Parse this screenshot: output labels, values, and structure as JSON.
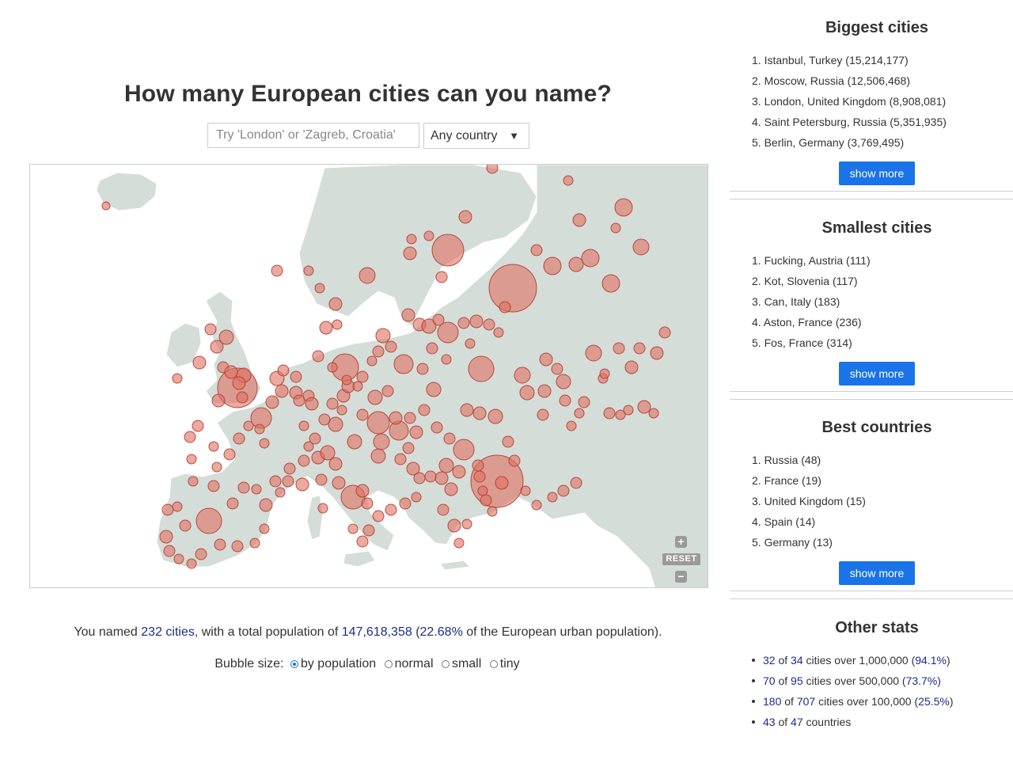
{
  "title": "How many European cities can you name?",
  "search": {
    "placeholder": "Try 'London' or 'Zagreb, Croatia'"
  },
  "country_select": {
    "selected": "Any country",
    "arrow": "▼"
  },
  "map": {
    "land_color": "#d4ddd8",
    "bubble_color": "#e07060",
    "zoom_in": "+",
    "reset": "RESET",
    "zoom_out": "−"
  },
  "summary": {
    "prefix": "You named ",
    "cities": "232 cities",
    "mid": ", with a total population of ",
    "population": "147,618,358",
    "open": " (",
    "percent": "22.68%",
    "suffix": " of the European urban population)."
  },
  "bubble_size": {
    "label": "Bubble size:",
    "options": [
      {
        "label": "by population",
        "checked": true
      },
      {
        "label": "normal",
        "checked": false
      },
      {
        "label": "small",
        "checked": false
      },
      {
        "label": "tiny",
        "checked": false
      }
    ]
  },
  "biggest": {
    "title": "Biggest cities",
    "items": [
      "1. Istanbul, Turkey (15,214,177)",
      "2. Moscow, Russia (12,506,468)",
      "3. London, United Kingdom (8,908,081)",
      "4. Saint Petersburg, Russia (5,351,935)",
      "5. Berlin, Germany (3,769,495)"
    ],
    "button": "show more"
  },
  "smallest": {
    "title": "Smallest cities",
    "items": [
      "1. Fucking, Austria (111)",
      "2. Kot, Slovenia (117)",
      "3. Can, Italy (183)",
      "4. Aston, France (236)",
      "5. Fos, France (314)"
    ],
    "button": "show more"
  },
  "best": {
    "title": "Best countries",
    "items": [
      "1. Russia (48)",
      "2. France (19)",
      "3. United Kingdom (15)",
      "4. Spain (14)",
      "5. Germany (13)"
    ],
    "button": "show more"
  },
  "other": {
    "title": "Other stats",
    "items": [
      {
        "a": "32",
        "m1": " of ",
        "b": "34",
        "m2": " cities over 1,000,000 (",
        "p": "94.1%",
        "e": ")"
      },
      {
        "a": "70",
        "m1": " of ",
        "b": "95",
        "m2": " cities over 500,000 (",
        "p": "73.7%",
        "e": ")"
      },
      {
        "a": "180",
        "m1": " of ",
        "b": "707",
        "m2": " cities over 100,000 (",
        "p": "25.5%",
        "e": ")"
      },
      {
        "a": "43",
        "m1": " of ",
        "b": "47",
        "m2": " countries",
        "p": "",
        "e": ""
      }
    ]
  }
}
